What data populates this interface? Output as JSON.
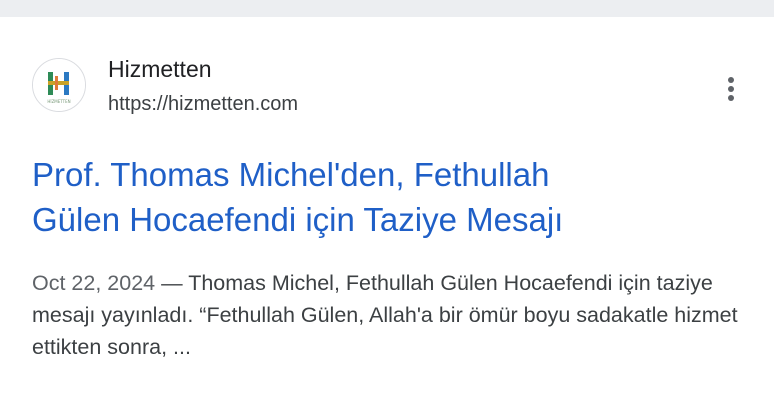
{
  "result": {
    "favicon_icon": "hizmetten-logo-icon",
    "favicon_letter": "H",
    "site_name": "Hizmetten",
    "url": "https://hizmetten.com",
    "more_icon": "more-vert-icon",
    "title_line1": "Prof. Thomas Michel'den, Fethullah",
    "title_line2": "Gülen Hocaefendi için Taziye Mesajı",
    "date": "Oct 22, 2024",
    "separator": " — ",
    "snippet_text": "Thomas Michel, Fethullah Gülen Hocaefendi için taziye mesajı yayınladı. “Fethullah Gülen, Allah'a bir ömür boyu sadakatle hizmet ettikten sonra, ..."
  },
  "colors": {
    "title_link": "#1f5fc7",
    "logo_green": "#2e8b57",
    "logo_gold": "#c9a227",
    "logo_blue": "#2b79c2"
  }
}
